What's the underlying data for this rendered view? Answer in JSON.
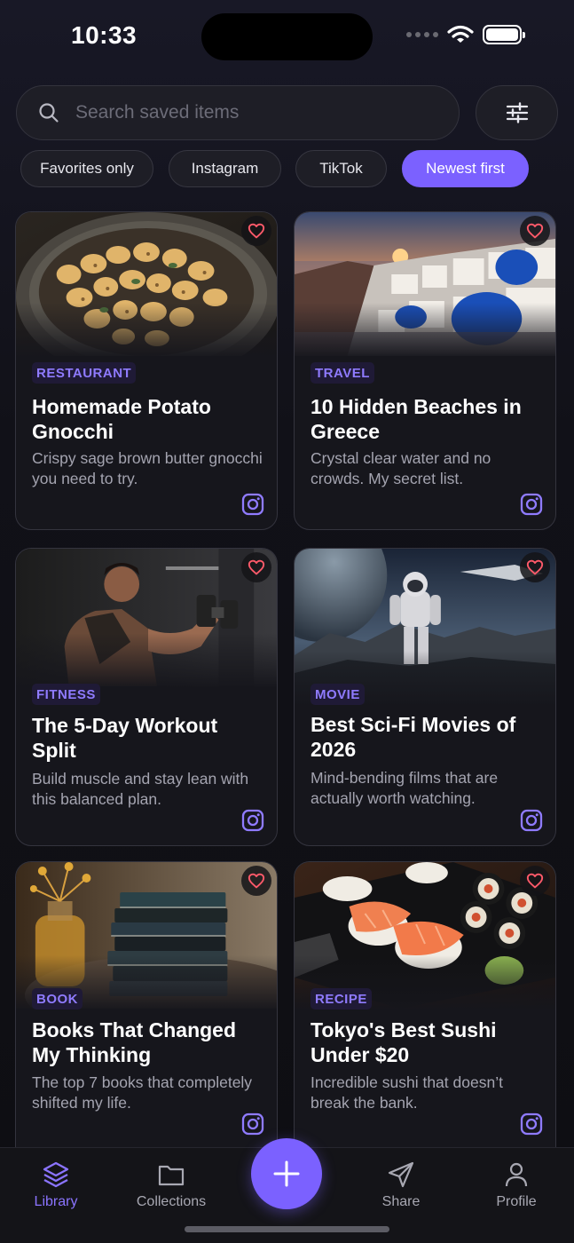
{
  "status_bar": {
    "time": "10:33"
  },
  "search": {
    "placeholder": "Search saved items"
  },
  "filters": [
    {
      "label": "Favorites only",
      "active": false
    },
    {
      "label": "Instagram",
      "active": false
    },
    {
      "label": "TikTok",
      "active": false
    },
    {
      "label": "Newest first",
      "active": true
    }
  ],
  "cards": [
    {
      "category": "RESTAURANT",
      "title": "Homemade Potato Gnocchi",
      "description": "Crispy sage brown butter gnocchi you need to try.",
      "source": "instagram",
      "image": "gnocchi-pan-photo"
    },
    {
      "category": "TRAVEL",
      "title": "10 Hidden Beaches in Greece",
      "description": "Crystal clear water and no crowds. My secret list.",
      "source": "instagram",
      "image": "santorini-sunset-photo"
    },
    {
      "category": "FITNESS",
      "title": "The 5-Day Workout Split",
      "description": "Build muscle and stay lean with this balanced plan.",
      "source": "instagram",
      "image": "dumbbell-curl-photo"
    },
    {
      "category": "MOVIE",
      "title": "Best Sci-Fi Movies of 2026",
      "description": "Mind-bending films that are actually worth watching.",
      "source": "instagram",
      "image": "astronaut-planet-photo"
    },
    {
      "category": "BOOK",
      "title": "Books That Changed My Thinking",
      "description": "The top 7 books that completely shifted my life.",
      "source": "instagram",
      "image": "book-stack-photo"
    },
    {
      "category": "RECIPE",
      "title": "Tokyo's Best Sushi Under $20",
      "description": "Incredible sushi that doesn’t break the bank.",
      "source": "instagram",
      "image": "sushi-platter-photo"
    }
  ],
  "nav": {
    "library": "Library",
    "collections": "Collections",
    "share": "Share",
    "profile": "Profile",
    "active": "library"
  },
  "colors": {
    "accent": "#7b61ff",
    "background": "#111118",
    "card": "#16161c",
    "heart": "#ff5a6a"
  }
}
